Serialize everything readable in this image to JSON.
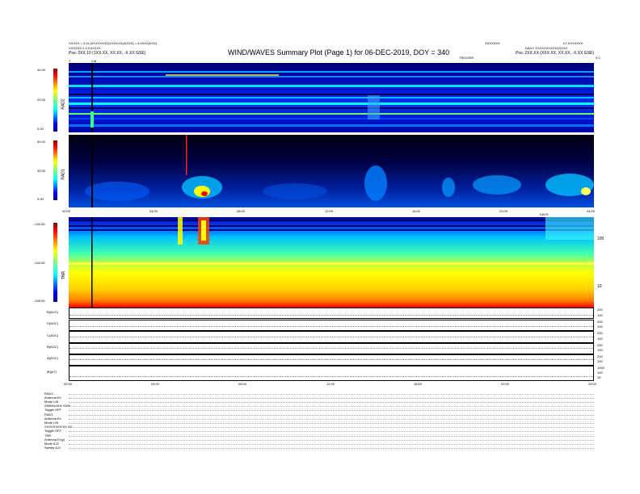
{
  "header": {
    "left_line1": "XXXXX = 3.11 [XXXXXXXX(XXXXXX)/XXXX] = 4.5XXX[XXX]",
    "left_line2": "XXXXXX 2.3.XXXXXX",
    "left_line3": "Pos: 2XX.10 (1XX.XX, XX.XX, -X.XX GSE)",
    "title": "WIND/WAVES Summary Plot (Page 1) for 06-DEC-2019, DOY = 340",
    "right_line1": "XXXXXXX",
    "right_line1b": "L2 XXXXXXX",
    "right_line2": "DAILY XXXXXXXXXXXXXXX",
    "right_line3": "Pos: 2XX.XX (XXX.XX, XX.XX, -X.XX GSE)",
    "top_label": "TRIGGER"
  },
  "axes": {
    "rad2": {
      "label": "RAD2",
      "ticks": [
        "40.00",
        "20.00",
        "0.00"
      ]
    },
    "rad1": {
      "label": "RAD1",
      "ticks": [
        "50.00",
        "30.00",
        "0.00"
      ]
    },
    "tnr": {
      "label": "TNR",
      "ticks": [
        "-130.00",
        "-142.50",
        "-155.00"
      ],
      "right_ticks": [
        "100",
        "10"
      ],
      "right_label": "DAYS"
    },
    "time_ticks": [
      "00:00",
      "04:00",
      "08:00",
      "12:00",
      "16:00",
      "20:00",
      "24:00"
    ],
    "corner_left": "Y",
    "corner_cal": "Cal",
    "corner_right": "9.0"
  },
  "line_panels": [
    {
      "label": "B(AGC)",
      "right": [
        "200",
        "100"
      ]
    },
    {
      "label": "D(AGC)",
      "right": [
        "200",
        "100"
      ]
    },
    {
      "label": "C(AGC)",
      "right": [
        "200",
        "100"
      ]
    },
    {
      "label": "B(AGC)",
      "right": [
        "200",
        "100"
      ]
    },
    {
      "label": "A(AGC)",
      "right": [
        "200",
        "100"
      ]
    },
    {
      "label": "|B|(nT)",
      "right": [
        "1000",
        "100",
        "10"
      ]
    }
  ],
  "info": {
    "rad2": [
      "RAD2",
      "Antenna   Ex",
      "Mode   LIN",
      "256kHz/3Hz  SUM",
      "Toggle   OFF"
    ],
    "rad1": [
      "RAD1",
      "Antenna   Ex",
      "Mode   LIN",
      "XXXXXXXX/XX  XX",
      "Toggle   OFF"
    ],
    "tnr": [
      "TNR",
      "Antenna   Ex(y)",
      "Mode   A-D",
      "Sweep   A-D"
    ]
  },
  "colors": {
    "deep_blue": "#000060",
    "blue": "#0000ff",
    "cyan": "#00ffff",
    "green": "#00ff00",
    "yellow": "#ffff00",
    "red": "#ff0000"
  }
}
